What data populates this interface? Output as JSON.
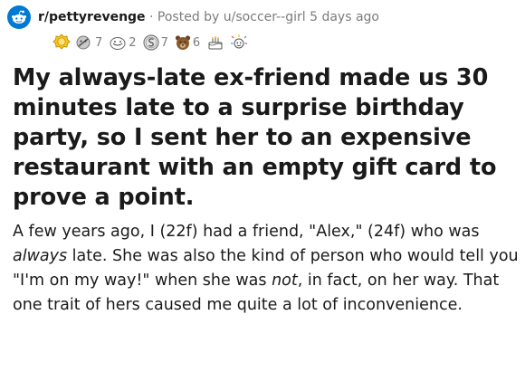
{
  "post": {
    "subreddit": "r/pettyrevenge",
    "separator": "·",
    "posted_by_prefix": "Posted by",
    "author": "u/soccer--girl",
    "time_ago": "5 days ago",
    "title": "My always-late ex-friend made us 30 minutes late to a surprise birthday party, so I sent her to an expensive restaurant with an empty gift card to prove a point.",
    "body": {
      "p1": "A few years ago, I (22f) had a friend, \"Alex,\" (24f) who was ",
      "em1": "always",
      "p2": " late. She was also the kind of person who would tell you \"I'm on my way!\" when she was ",
      "em2": "not",
      "p3": ", in fact, on her way. That one trait of hers caused me quite a lot of inconvenience."
    }
  },
  "awards": [
    {
      "name": "gold-award-icon",
      "count": ""
    },
    {
      "name": "hug-award-icon",
      "count": "7"
    },
    {
      "name": "wholesome-award-icon",
      "count": "2"
    },
    {
      "name": "silver-coin-award-icon",
      "count": "7"
    },
    {
      "name": "bear-award-icon",
      "count": "6"
    },
    {
      "name": "cake-award-icon",
      "count": ""
    },
    {
      "name": "confetti-award-icon",
      "count": ""
    }
  ],
  "colors": {
    "brand": "#0079d3",
    "text": "#1a1a1b",
    "meta": "#7c7c7c"
  }
}
